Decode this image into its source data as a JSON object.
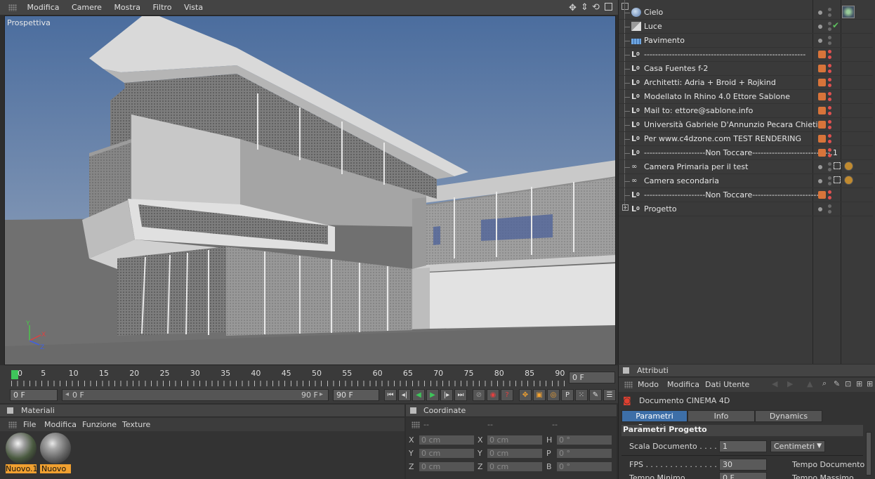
{
  "viewport": {
    "menu": [
      "Modifica",
      "Camere",
      "Mostra",
      "Filtro",
      "Vista"
    ],
    "label": "Prospettiva",
    "axes": {
      "x": "X",
      "y": "Y",
      "z": "Z"
    }
  },
  "object_manager": {
    "rows": [
      {
        "name": "Cielo",
        "icon": "sky-icon",
        "layer": false,
        "extra": "sky-texture-tag"
      },
      {
        "name": "Luce",
        "icon": "light-icon",
        "layer": false,
        "extra": "check-icon"
      },
      {
        "name": "Pavimento",
        "icon": "floor-icon",
        "layer": false
      },
      {
        "name": "----------------------------------------------------------",
        "icon": "null-icon",
        "layer": true
      },
      {
        "name": "Casa Fuentes  f-2",
        "icon": "null-icon",
        "layer": true
      },
      {
        "name": "Architetti: Adria + Broid + Rojkind",
        "icon": "null-icon",
        "layer": true
      },
      {
        "name": "Modellato In Rhino 4.0  Ettore Sablone",
        "icon": "null-icon",
        "layer": true
      },
      {
        "name": "Mail to: ettore@sablone.info",
        "icon": "null-icon",
        "layer": true
      },
      {
        "name": "Università  Gabriele D'Annunzio Pecara Chieti",
        "icon": "null-icon",
        "layer": true
      },
      {
        "name": "Per www.c4dzone.com TEST RENDERING",
        "icon": "null-icon",
        "layer": true
      },
      {
        "name": "----------------------Non Toccare----------------------------.1",
        "icon": "null-icon",
        "layer": true
      },
      {
        "name": "Camera Primaria per il test",
        "icon": "camera-icon",
        "layer": false,
        "extra": "camera-tags"
      },
      {
        "name": "Camera secondaria",
        "icon": "camera-icon",
        "layer": false,
        "extra": "camera-tags"
      },
      {
        "name": "----------------------Non Toccare-------------------------",
        "icon": "null-icon",
        "layer": true
      },
      {
        "name": "Progetto",
        "icon": "null-icon",
        "layer": false,
        "expand": true
      }
    ]
  },
  "timeline": {
    "ticks": [
      "0",
      "5",
      "10",
      "15",
      "20",
      "25",
      "30",
      "35",
      "40",
      "45",
      "50",
      "55",
      "60",
      "65",
      "70",
      "75",
      "80",
      "85",
      "90"
    ],
    "current_frame": "0 F",
    "start_frame": "0 F",
    "range_start": "0 F",
    "range_end": "90 F",
    "end_frame": "90 F"
  },
  "materials": {
    "title": "Materiali",
    "menu": [
      "File",
      "Modifica",
      "Funzione",
      "Texture"
    ],
    "items": [
      {
        "name": "Nuovo.1"
      },
      {
        "name": "Nuovo"
      }
    ]
  },
  "coordinates": {
    "title": "Coordinate",
    "headers": [
      "--",
      "--",
      "--"
    ],
    "rows": [
      {
        "a": "X",
        "av": "0 cm",
        "b": "X",
        "bv": "0 cm",
        "c": "H",
        "cv": "0 °"
      },
      {
        "a": "Y",
        "av": "0 cm",
        "b": "Y",
        "bv": "0 cm",
        "c": "P",
        "cv": "0 °"
      },
      {
        "a": "Z",
        "av": "0 cm",
        "b": "Z",
        "bv": "0 cm",
        "c": "B",
        "cv": "0 °"
      }
    ]
  },
  "attributes": {
    "title": "Attributi",
    "menu": [
      "Modo",
      "Modifica",
      "Dati Utente"
    ],
    "document": "Documento CINEMA 4D",
    "tabs": [
      "Parametri Progetto",
      "Info",
      "Dynamics"
    ],
    "section": "Parametri Progetto",
    "scala_label": "Scala Documento . . . . . .",
    "scala_value": "1",
    "scala_unit": "Centimetri",
    "fps_label": "FPS . . . . . . . . . . . . . . . . . .",
    "fps_value": "30",
    "tempo_doc": "Tempo Documento .",
    "tempo_min": "Tempo Minimo . . . . . . . .",
    "tempo_min_value": "0 F",
    "tempo_max": "Tempo Massimo ."
  },
  "colors": {
    "accent": "#3d6fa8",
    "layer": "#d8743a",
    "material_label": "#f0a030",
    "active_frame": "#3ec45a"
  }
}
